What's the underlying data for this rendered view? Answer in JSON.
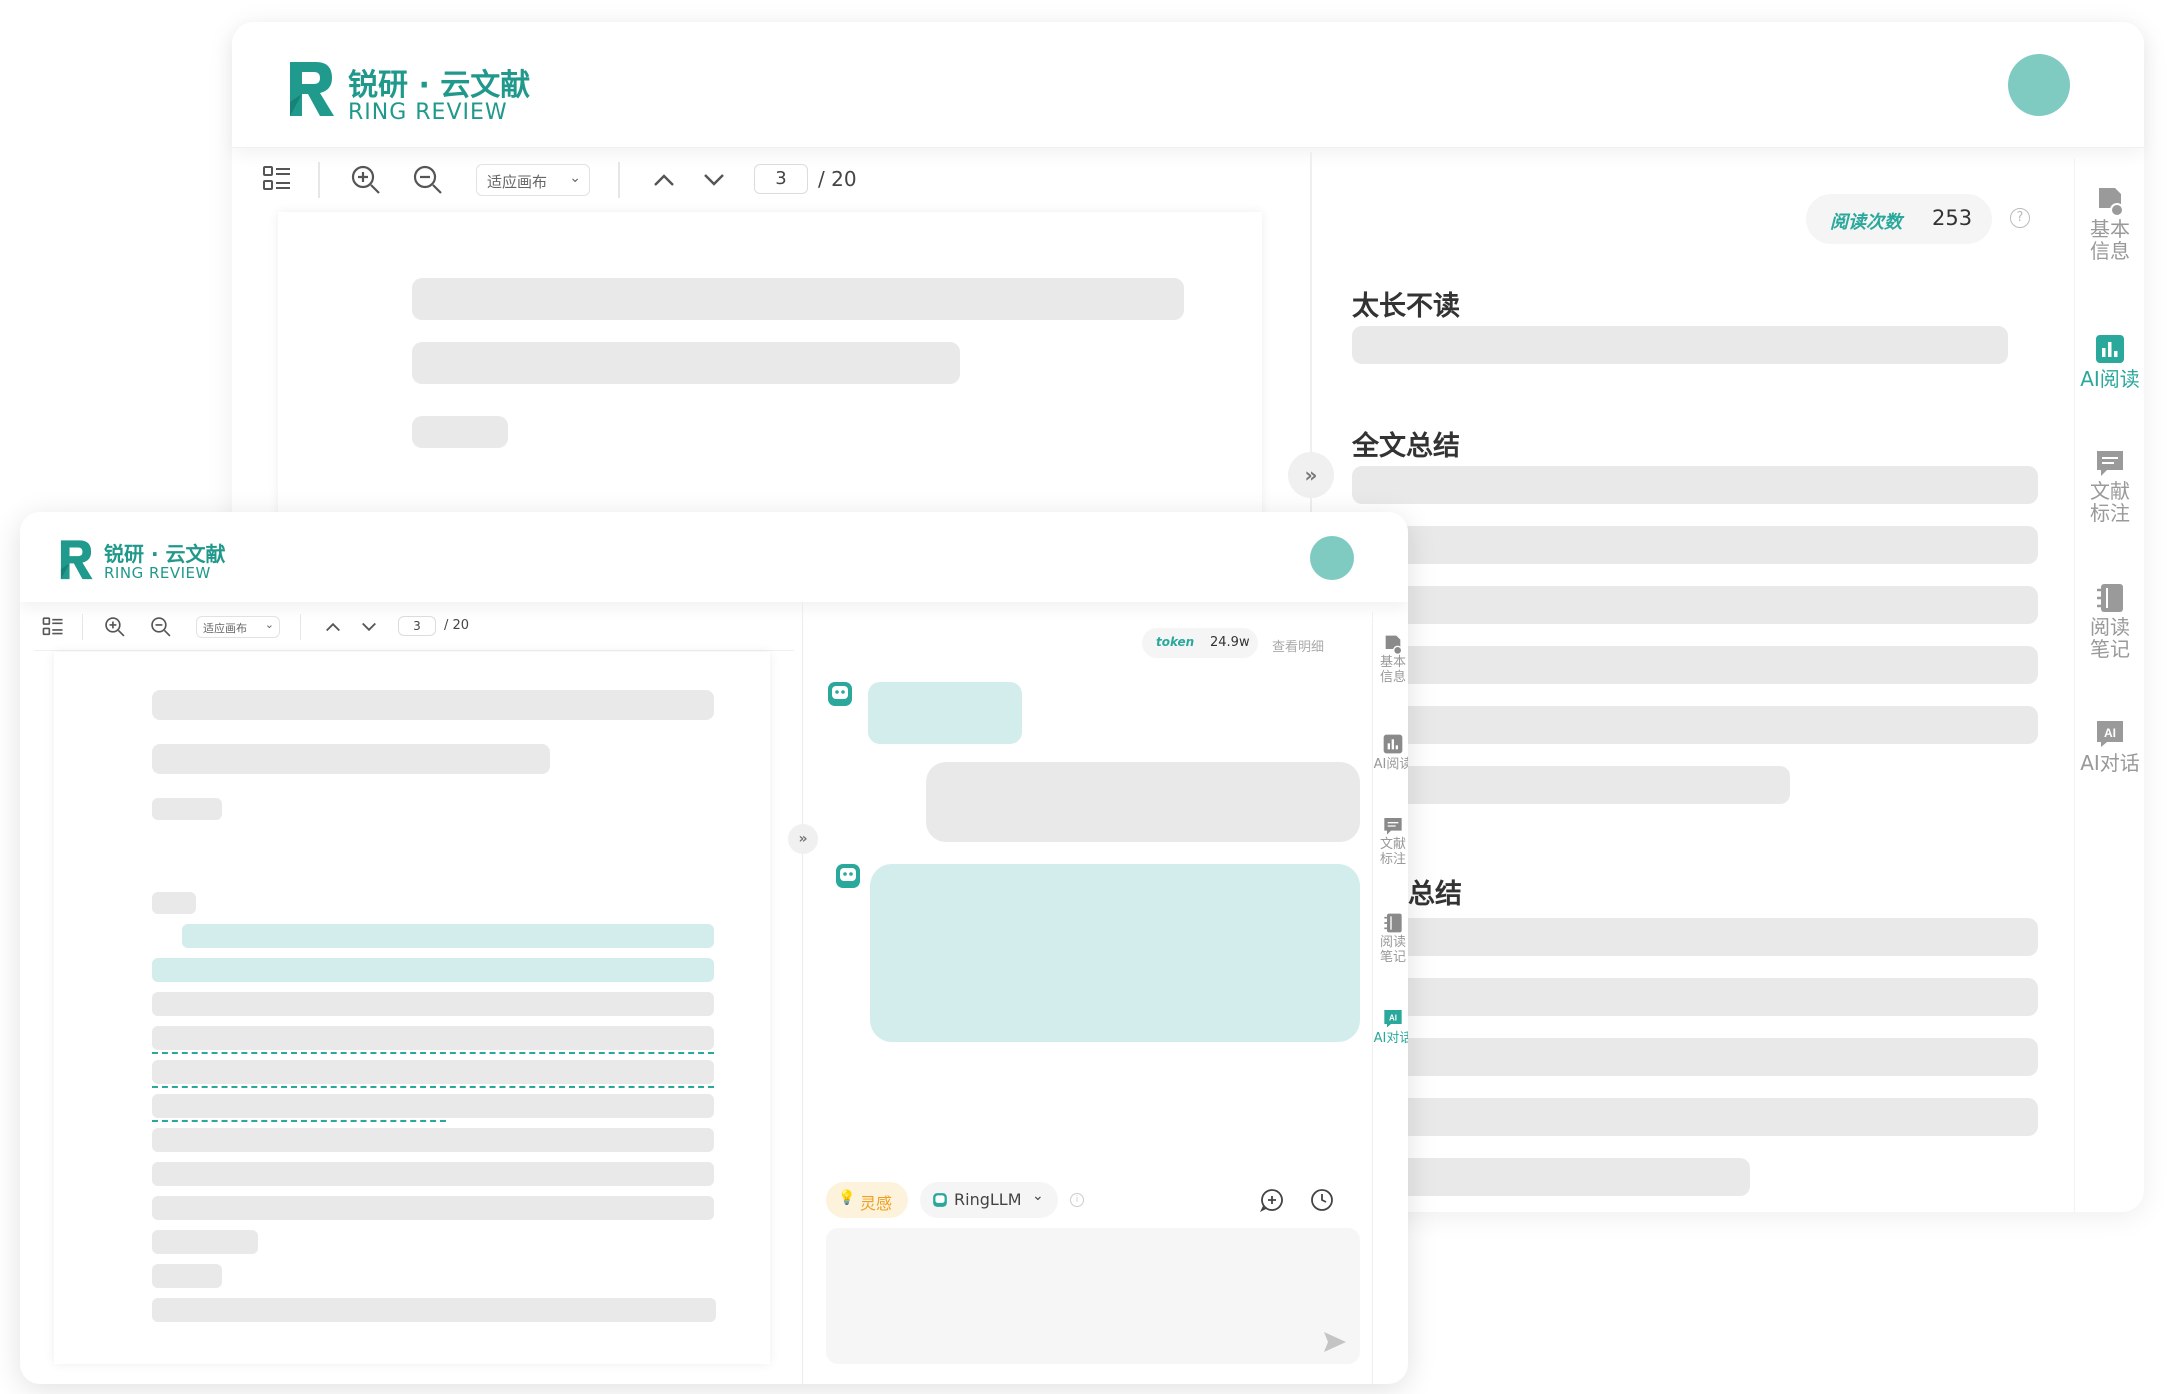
{
  "back": {
    "brand": {
      "cn": "锐研 · 云文献",
      "en": "RING REVIEW"
    },
    "toolbar": {
      "zoom_mode": "适应画布",
      "page_current": "3",
      "page_total": "/ 20"
    },
    "read_count": {
      "label": "阅读次数",
      "value": "253"
    },
    "sections": {
      "tldr": "太长不读",
      "summary": "全文总结",
      "summary2": "总结"
    },
    "sidebar": [
      {
        "label": "基本\n信息",
        "icon": "document-info-icon",
        "active": false
      },
      {
        "label": "AI阅读",
        "icon": "bar-chart-icon",
        "active": true
      },
      {
        "label": "文献\n标注",
        "icon": "comment-icon",
        "active": false
      },
      {
        "label": "阅读\n笔记",
        "icon": "notebook-icon",
        "active": false
      },
      {
        "label": "AI对话",
        "icon": "ai-badge-icon",
        "active": false
      }
    ]
  },
  "front": {
    "brand": {
      "cn": "锐研 · 云文献",
      "en": "RING REVIEW"
    },
    "toolbar": {
      "zoom_mode": "适应画布",
      "page_current": "3",
      "page_total": "/ 20"
    },
    "token": {
      "label": "token",
      "value": "24.9w",
      "detail_link": "查看明细"
    },
    "chat": {
      "inspiration": "灵感",
      "model": "RingLLM"
    },
    "sidebar": [
      {
        "label": "基本\n信息",
        "icon": "document-info-icon",
        "active": false
      },
      {
        "label": "AI阅读",
        "icon": "bar-chart-icon",
        "active": false
      },
      {
        "label": "文献\n标注",
        "icon": "comment-icon",
        "active": false
      },
      {
        "label": "阅读\n笔记",
        "icon": "notebook-icon",
        "active": false
      },
      {
        "label": "AI对话",
        "icon": "ai-badge-icon",
        "active": true
      }
    ]
  },
  "colors": {
    "accent": "#2aa89b",
    "bubble": "#d3ecec",
    "skeleton": "#e9e9e9",
    "inspiration": "#f0a020"
  }
}
